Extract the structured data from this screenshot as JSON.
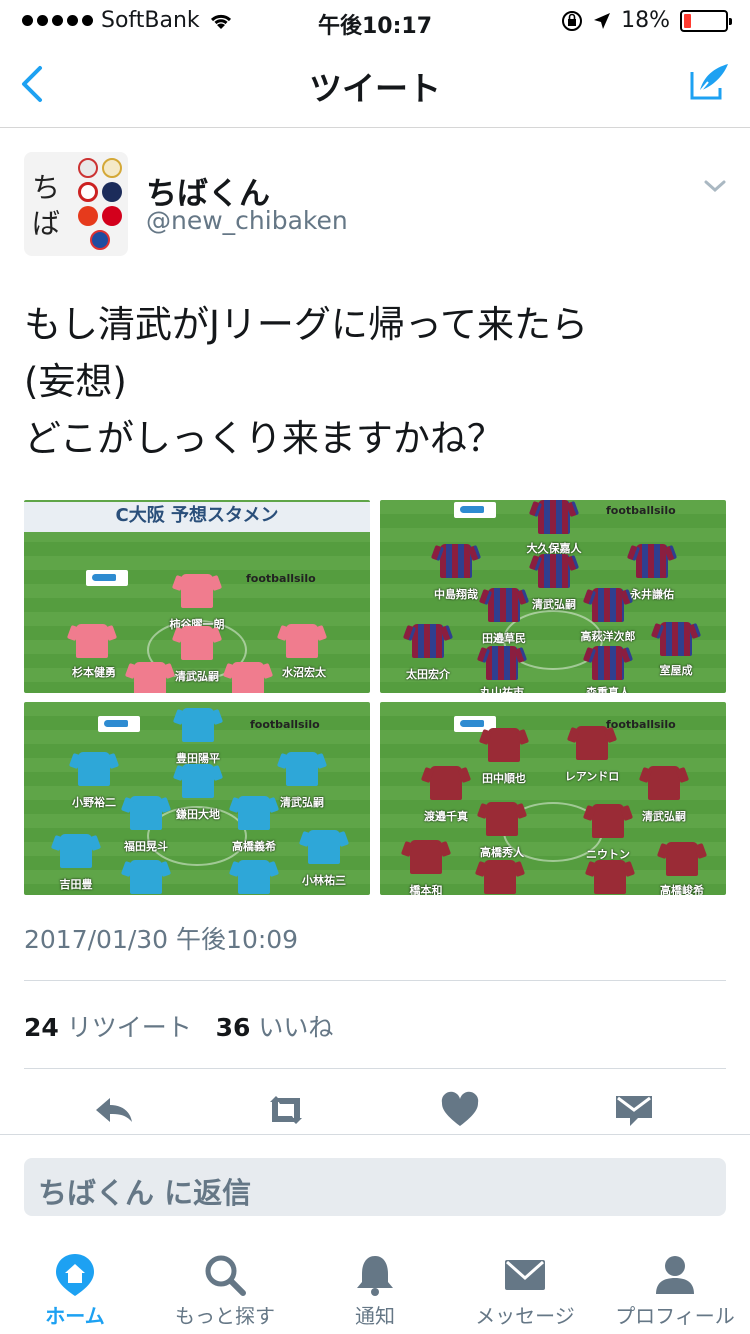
{
  "status_bar": {
    "carrier": "SoftBank",
    "time": "午後10:17",
    "battery": "18%",
    "battery_level": 0.18
  },
  "nav": {
    "title": "ツイート",
    "back_icon": "chevron-left-icon",
    "compose_icon": "compose-tweet-icon"
  },
  "tweet": {
    "avatar_text": "ち\nば",
    "name": "ちばくん",
    "handle": "@new_chibaken",
    "text": "もし清武がJリーグに帰って来たら\n(妄想)\nどこがしっくり来ますかね？",
    "timestamp": "2017/01/30 午後10:09",
    "retweet_count": "24",
    "retweet_label": "リツイート",
    "like_count": "36",
    "like_label": "いいね"
  },
  "media": {
    "brand": "footballsilo",
    "panels": [
      {
        "title": "C大阪 予想スタメン",
        "color": "#f07c8e",
        "players": [
          {
            "name": "柿谷曜一朗"
          },
          {
            "name": "杉本健勇"
          },
          {
            "name": "清武弘嗣"
          },
          {
            "name": "水沼宏太"
          }
        ]
      },
      {
        "title": "",
        "color": "#8b1e3f",
        "players": [
          {
            "name": "大久保嘉人"
          },
          {
            "name": "中島翔哉"
          },
          {
            "name": "清武弘嗣"
          },
          {
            "name": "永井謙佑"
          },
          {
            "name": "田邉草民"
          },
          {
            "name": "高萩洋次郎"
          },
          {
            "name": "太田宏介"
          },
          {
            "name": "室屋成"
          },
          {
            "name": "丸山祐市"
          },
          {
            "name": "森重真人"
          }
        ]
      },
      {
        "title": "",
        "color": "#2ea7d8",
        "players": [
          {
            "name": "豊田陽平"
          },
          {
            "name": "小野裕二"
          },
          {
            "name": "清武弘嗣"
          },
          {
            "name": "鎌田大地"
          },
          {
            "name": "福田晃斗"
          },
          {
            "name": "高橋義希"
          },
          {
            "name": "吉田豊"
          },
          {
            "name": "小林祐三"
          }
        ]
      },
      {
        "title": "",
        "color": "#9a2b36",
        "players": [
          {
            "name": "田中順也"
          },
          {
            "name": "レアンドロ"
          },
          {
            "name": "渡邉千真"
          },
          {
            "name": "清武弘嗣"
          },
          {
            "name": "高橋秀人"
          },
          {
            "name": "ニウトン"
          },
          {
            "name": "橋本和"
          },
          {
            "name": "高橋峻希"
          }
        ]
      }
    ]
  },
  "actions": {
    "reply_icon": "reply-icon",
    "retweet_icon": "retweet-icon",
    "like_icon": "heart-icon",
    "dm_icon": "direct-message-icon"
  },
  "reply_placeholder": "ちばくん に返信",
  "tabbar": {
    "tabs": [
      {
        "label": "ホーム",
        "icon": "home-icon",
        "active": true
      },
      {
        "label": "もっと探す",
        "icon": "search-icon",
        "active": false
      },
      {
        "label": "通知",
        "icon": "bell-icon",
        "active": false
      },
      {
        "label": "メッセージ",
        "icon": "envelope-icon",
        "active": false
      },
      {
        "label": "プロフィール",
        "icon": "person-icon",
        "active": false
      }
    ]
  },
  "colors": {
    "accent": "#1da1f2",
    "secondary_text": "#657786",
    "divider": "#d6dbe0"
  }
}
